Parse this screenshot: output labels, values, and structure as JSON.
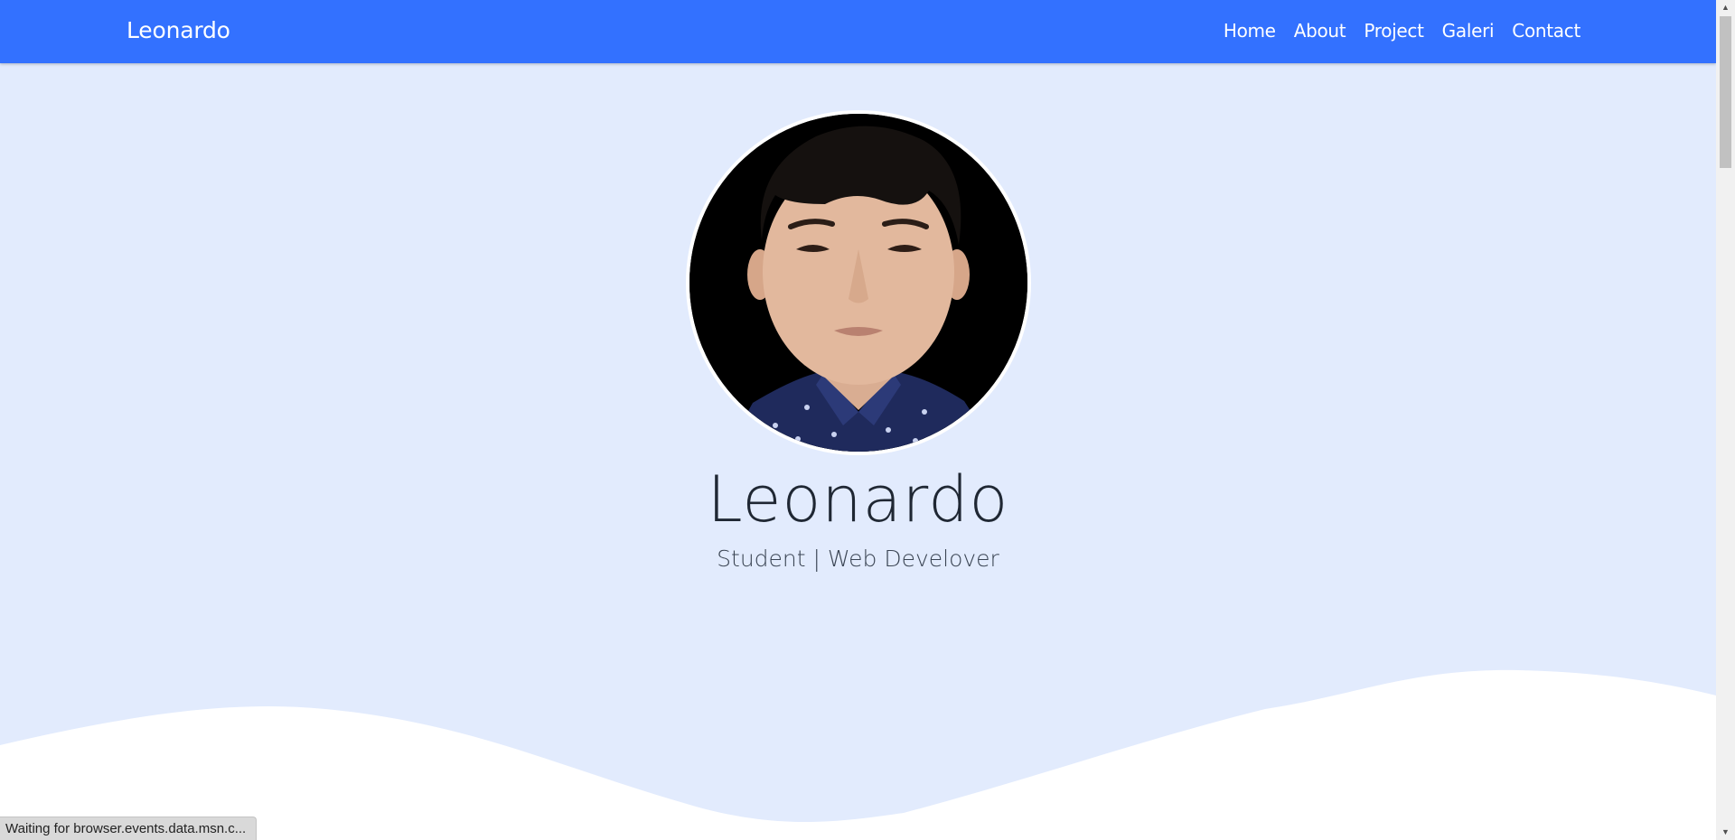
{
  "navbar": {
    "brand": "Leonardo",
    "links": [
      "Home",
      "About",
      "Project",
      "Galeri",
      "Contact"
    ]
  },
  "hero": {
    "name": "Leonardo",
    "subtitle": "Student | Web Develover"
  },
  "status_bar": {
    "text": "Waiting for browser.events.data.msn.c..."
  },
  "colors": {
    "navbar_bg": "#3371ff",
    "hero_bg": "#e2ebfd",
    "wave": "#ffffff"
  }
}
